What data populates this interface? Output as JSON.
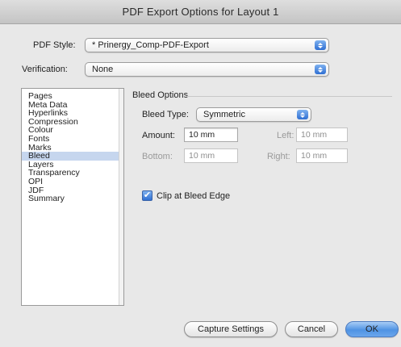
{
  "window": {
    "title": "PDF Export Options for Layout 1"
  },
  "pdf_style": {
    "label": "PDF Style:",
    "value": "* Prinergy_Comp-PDF-Export"
  },
  "verification": {
    "label": "Verification:",
    "value": "None"
  },
  "sidebar": {
    "items": [
      {
        "label": "Pages"
      },
      {
        "label": "Meta Data"
      },
      {
        "label": "Hyperlinks"
      },
      {
        "label": "Compression"
      },
      {
        "label": "Colour"
      },
      {
        "label": "Fonts"
      },
      {
        "label": "Marks"
      },
      {
        "label": "Bleed",
        "selected": true
      },
      {
        "label": "Layers"
      },
      {
        "label": "Transparency"
      },
      {
        "label": "OPI"
      },
      {
        "label": "JDF"
      },
      {
        "label": "Summary"
      }
    ]
  },
  "bleed": {
    "group_title": "Bleed Options",
    "type_label": "Bleed Type:",
    "type_value": "Symmetric",
    "amount_label": "Amount:",
    "amount_value": "10 mm",
    "left_label": "Left:",
    "left_value": "10 mm",
    "bottom_label": "Bottom:",
    "bottom_value": "10 mm",
    "right_label": "Right:",
    "right_value": "10 mm",
    "clip_label": "Clip at Bleed Edge",
    "clip_checked": true
  },
  "buttons": {
    "capture": "Capture Settings",
    "cancel": "Cancel",
    "ok": "OK"
  },
  "colors": {
    "accent": "#4f93e3",
    "selection": "#c6d6ee"
  }
}
